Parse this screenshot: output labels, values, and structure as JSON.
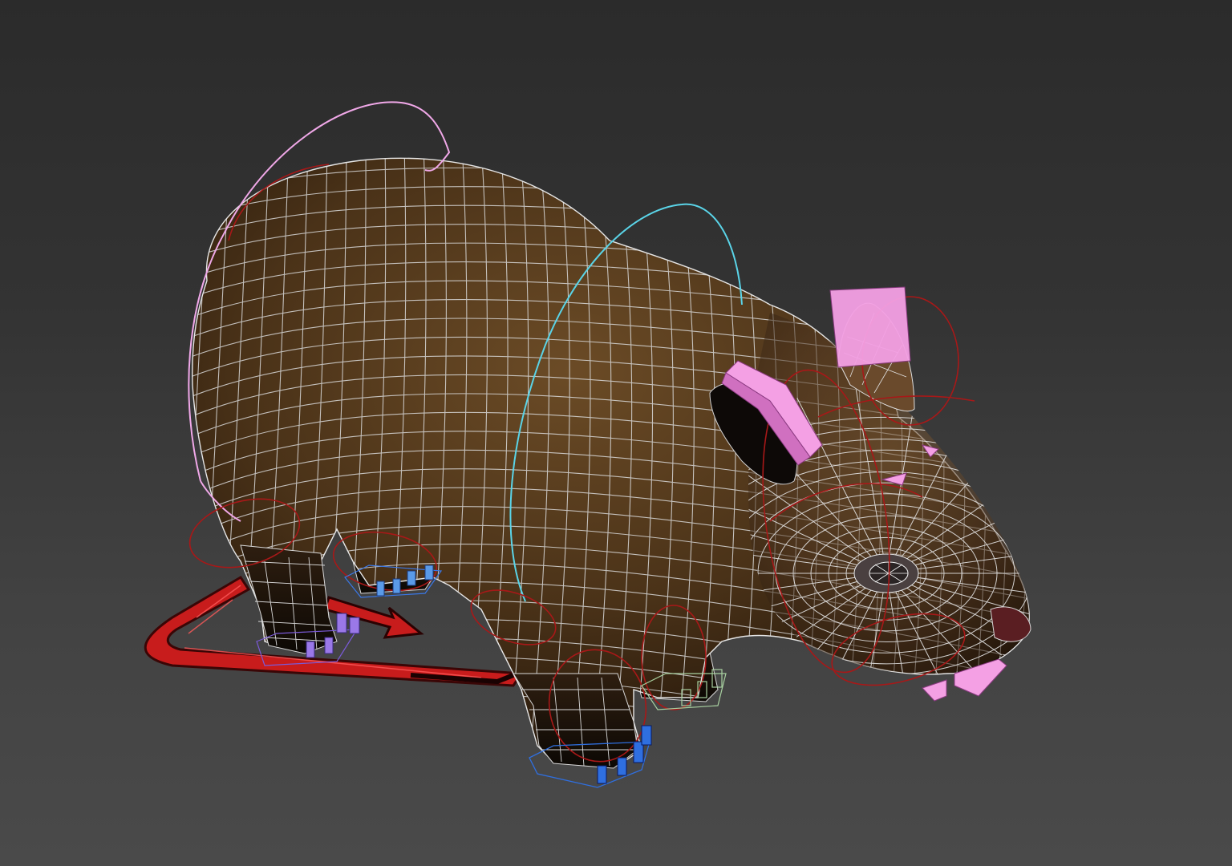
{
  "viewport": {
    "background_top": "#2b2b2b",
    "background_bottom": "#4a4a4a",
    "shading_mode": "textured-wireframe"
  },
  "model": {
    "kind": "rat",
    "body_color": "#5b4022",
    "body_dark": "#2a1a0c",
    "wire_color": "#d9d9d9"
  },
  "rig": {
    "spine_ring_color": "#f0a8e8",
    "neck_ring_color": "#5ad4e8",
    "limb_circle_color": "#a81818",
    "ear_box_color": "#f4a0e4",
    "jaw_box_color": "#f4a0e4",
    "root_arrow_color": "#c81c1c",
    "foot_front_color": "#2f6fe0",
    "foot_back_color": "#9a78e8",
    "foot_mid_color": "#a8d0a0"
  },
  "icons": [
    "root-arrow-icon",
    "spine-ring-icon",
    "neck-ring-icon"
  ]
}
